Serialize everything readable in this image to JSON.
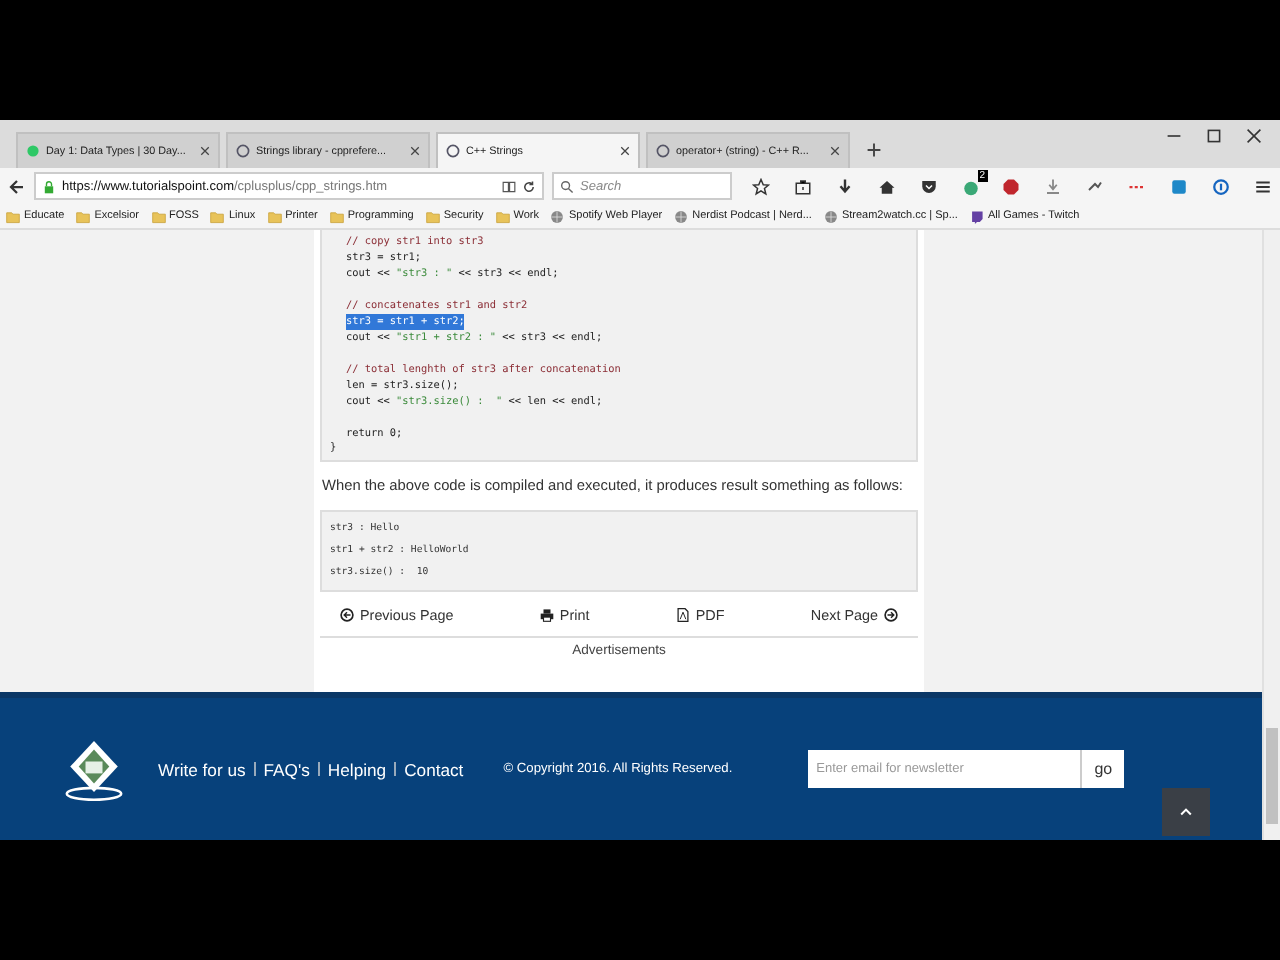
{
  "tabs": [
    {
      "title": "Day 1: Data Types | 30 Day...",
      "selected": false
    },
    {
      "title": "Strings library - cpprefere...",
      "selected": false
    },
    {
      "title": "C++ Strings",
      "selected": true
    },
    {
      "title": "operator+ (string) - C++ R...",
      "selected": false
    }
  ],
  "address": {
    "url_host": "https://www.tutorialspoint.com",
    "url_path": "/cplusplus/cpp_strings.htm"
  },
  "search": {
    "placeholder": "Search"
  },
  "extension_badge": "2",
  "bookmarks": [
    {
      "label": "Educate",
      "kind": "folder"
    },
    {
      "label": "Excelsior",
      "kind": "folder"
    },
    {
      "label": "FOSS",
      "kind": "folder"
    },
    {
      "label": "Linux",
      "kind": "folder"
    },
    {
      "label": "Printer",
      "kind": "folder"
    },
    {
      "label": "Programming",
      "kind": "folder"
    },
    {
      "label": "Security",
      "kind": "folder"
    },
    {
      "label": "Work",
      "kind": "folder"
    },
    {
      "label": "Spotify Web Player",
      "kind": "site"
    },
    {
      "label": "Nerdist Podcast | Nerd...",
      "kind": "site"
    },
    {
      "label": "Stream2watch.cc | Sp...",
      "kind": "site"
    },
    {
      "label": "All Games - Twitch",
      "kind": "twitch"
    }
  ],
  "code": {
    "blocks": [
      {
        "lines": [
          {
            "parts": [
              {
                "text": "// copy str1 into str3",
                "kind": "comment"
              }
            ],
            "selected": false
          },
          {
            "parts": [
              {
                "text": "str3 = str1;",
                "kind": "code"
              }
            ],
            "selected": false
          },
          {
            "parts": [
              {
                "text": "cout << ",
                "kind": "code"
              },
              {
                "text": "\"str3 : \"",
                "kind": "string"
              },
              {
                "text": " << str3 << endl;",
                "kind": "code"
              }
            ],
            "selected": false
          }
        ]
      },
      {
        "lines": [
          {
            "parts": [
              {
                "text": "// concatenates str1 and str2",
                "kind": "comment"
              }
            ],
            "selected": false
          },
          {
            "parts": [
              {
                "text": "str3 = str1 + str2;",
                "kind": "code"
              }
            ],
            "selected": true
          },
          {
            "parts": [
              {
                "text": "cout << ",
                "kind": "code"
              },
              {
                "text": "\"str1 + str2 : \"",
                "kind": "string"
              },
              {
                "text": " << str3 << endl;",
                "kind": "code"
              }
            ],
            "selected": false
          }
        ]
      },
      {
        "lines": [
          {
            "parts": [
              {
                "text": "// total lenghth of str3 after concatenation",
                "kind": "comment"
              }
            ],
            "selected": false
          },
          {
            "parts": [
              {
                "text": "len = str3.size();",
                "kind": "code"
              }
            ],
            "selected": false
          },
          {
            "parts": [
              {
                "text": "cout << ",
                "kind": "code"
              },
              {
                "text": "\"str3.size() :  \"",
                "kind": "string"
              },
              {
                "text": " << len << endl;",
                "kind": "code"
              }
            ],
            "selected": false
          }
        ]
      },
      {
        "lines": [
          {
            "parts": [
              {
                "text": "return 0;",
                "kind": "code"
              }
            ],
            "selected": false
          }
        ]
      }
    ],
    "closing": "}"
  },
  "paragraph": "When the above code is compiled and executed, it produces result something as follows:",
  "output": [
    "str3 : Hello",
    "str1 + str2 : HelloWorld",
    "str3.size() :  10"
  ],
  "page_nav": [
    {
      "label": "Previous Page",
      "kind": "prev"
    },
    {
      "label": "Print",
      "kind": "print"
    },
    {
      "label": "PDF",
      "kind": "pdf"
    },
    {
      "label": "Next Page",
      "kind": "next"
    }
  ],
  "ads_label": "Advertisements",
  "footer": {
    "links": [
      "Write for us",
      "FAQ's",
      "Helping",
      "Contact"
    ],
    "copyright": "© Copyright 2016. All Rights Reserved.",
    "newsletter_placeholder": "Enter email for newsletter",
    "go_button": "go"
  }
}
